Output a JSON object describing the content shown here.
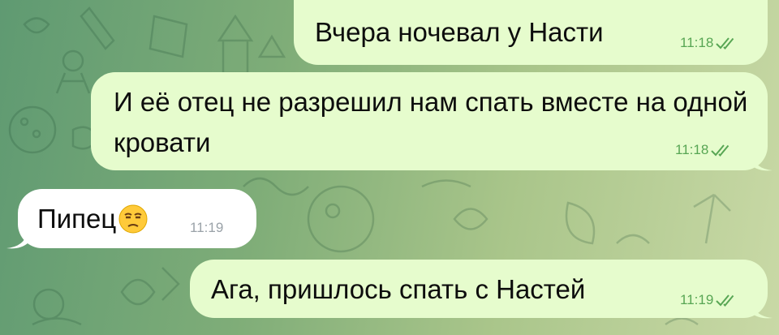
{
  "chat": {
    "messages": [
      {
        "direction": "outgoing",
        "text": "Вчера ночевал у Насти",
        "time": "11:18",
        "status": "read"
      },
      {
        "direction": "outgoing",
        "text": "И её отец не разрешил нам спать  вместе на одной кровати",
        "time": "11:18",
        "status": "read"
      },
      {
        "direction": "incoming",
        "text": "Пипец",
        "emoji": "unamused-face-icon",
        "time": "11:19"
      },
      {
        "direction": "outgoing",
        "text": "Ага, пришлось спать с Настей",
        "time": "11:19",
        "status": "read"
      }
    ]
  },
  "colors": {
    "outgoing_bubble": "#e6fccd",
    "incoming_bubble": "#ffffff",
    "read_check": "#58a654",
    "incoming_time": "#9aa2a8",
    "background_start": "#5f9a72",
    "background_end": "#c9d9a6"
  }
}
